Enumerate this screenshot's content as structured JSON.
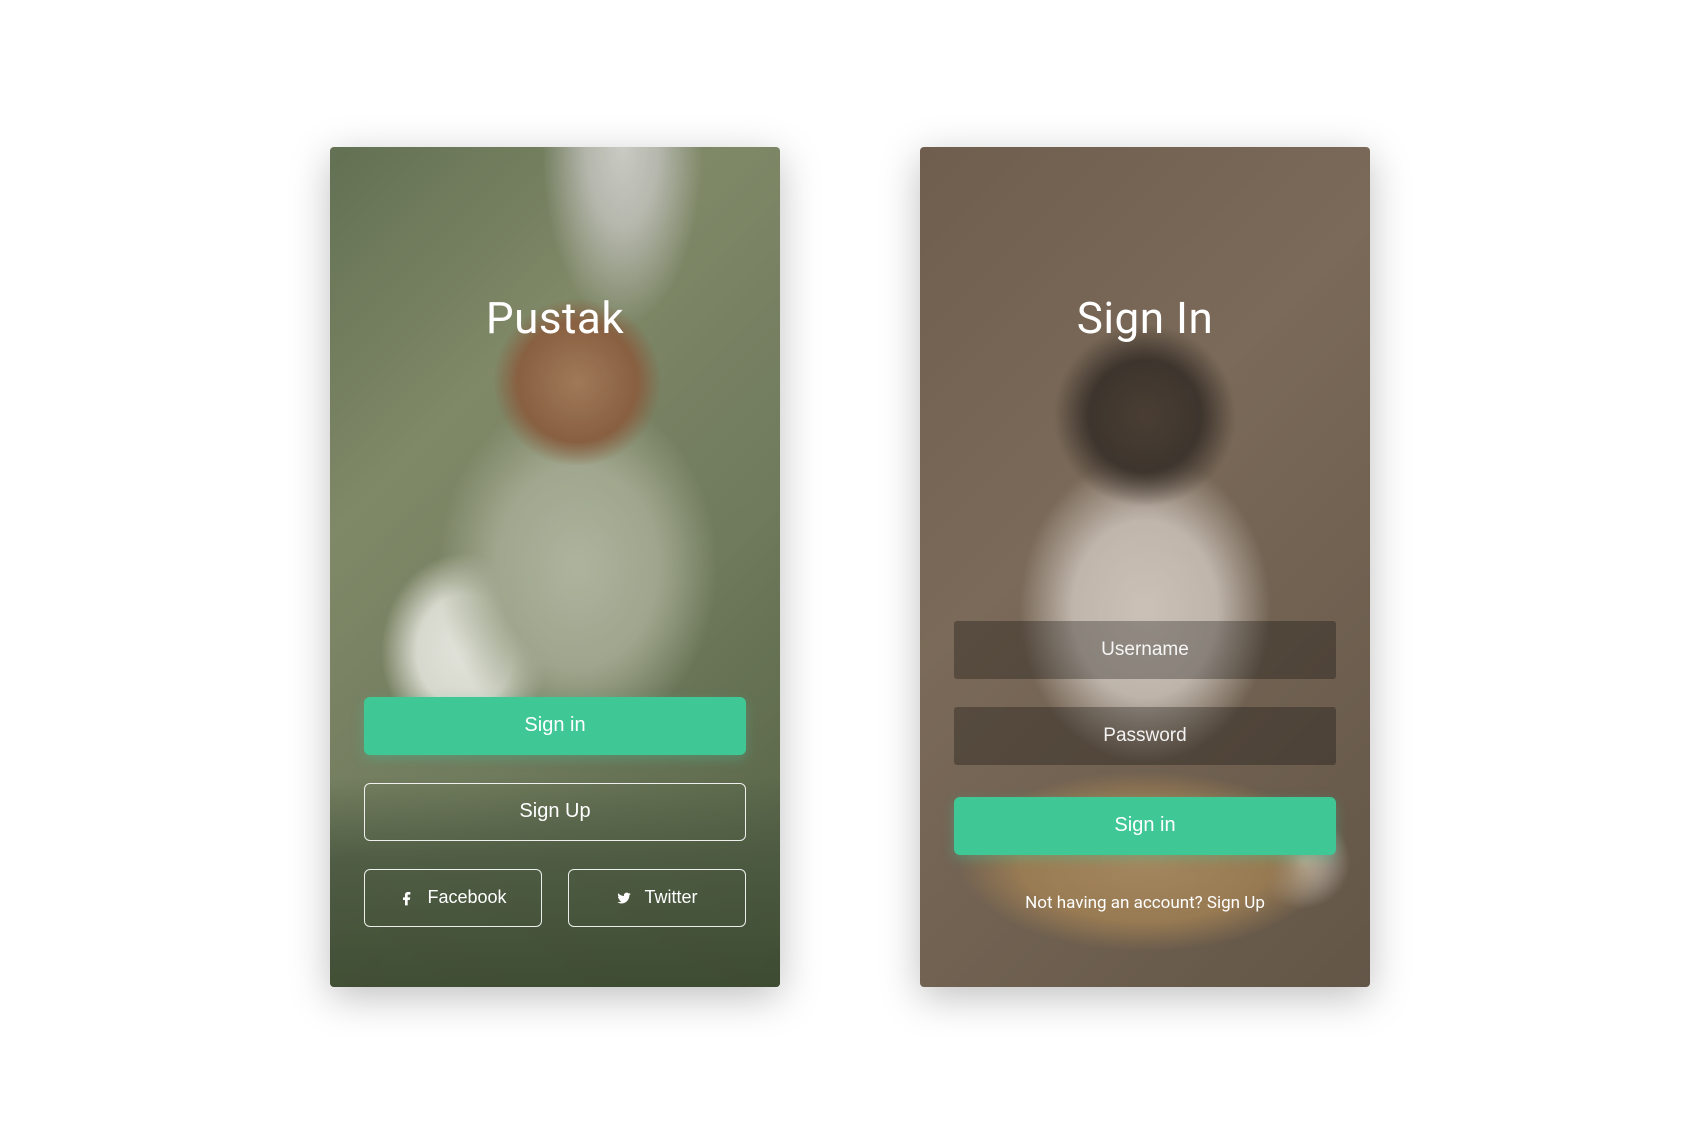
{
  "colors": {
    "primary": "#3fc796"
  },
  "screen1": {
    "title": "Pustak",
    "signin_label": "Sign in",
    "signup_label": "Sign Up",
    "facebook_label": "Facebook",
    "twitter_label": "Twitter"
  },
  "screen2": {
    "title": "Sign In",
    "username_placeholder": "Username",
    "password_placeholder": "Password",
    "signin_label": "Sign in",
    "signup_link": "Not having an account? Sign Up"
  }
}
